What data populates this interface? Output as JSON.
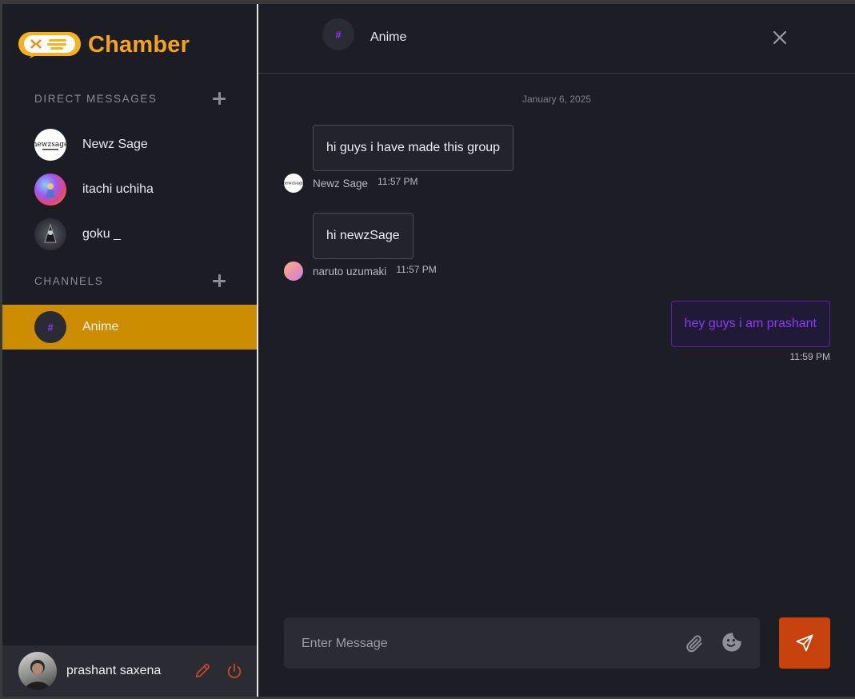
{
  "app": {
    "name": "Chamber"
  },
  "sidebar": {
    "dm_title": "DIRECT MESSAGES",
    "channels_title": "CHANNELS",
    "contacts": [
      {
        "name": "Newz Sage",
        "avatar": "newzsage-logo"
      },
      {
        "name": "itachi uchiha",
        "avatar": "anime-art"
      },
      {
        "name": "goku _",
        "avatar": "dark-figure"
      }
    ],
    "channels": [
      {
        "name": "Anime",
        "icon": "#",
        "active": true
      }
    ]
  },
  "profile": {
    "name": "prashant saxena"
  },
  "chat": {
    "title": "Anime",
    "icon": "#",
    "date": "January 6, 2025",
    "messages": [
      {
        "text": "hi guys i have made this group",
        "sender": "Newz Sage",
        "time": "11:57 PM"
      },
      {
        "text": "hi newzSage",
        "sender": "naruto uzumaki",
        "time": "11:57 PM"
      }
    ],
    "own_message": {
      "text": "hey guys i am prashant",
      "time": "11:59 PM"
    }
  },
  "composer": {
    "placeholder": "Enter Message",
    "value": ""
  },
  "colors": {
    "brand": "#f7a21b",
    "active_channel": "#cc8d00",
    "send_button": "#c8420d",
    "own_message": "#8b3df5",
    "icons_accent": "#d24a1f"
  }
}
